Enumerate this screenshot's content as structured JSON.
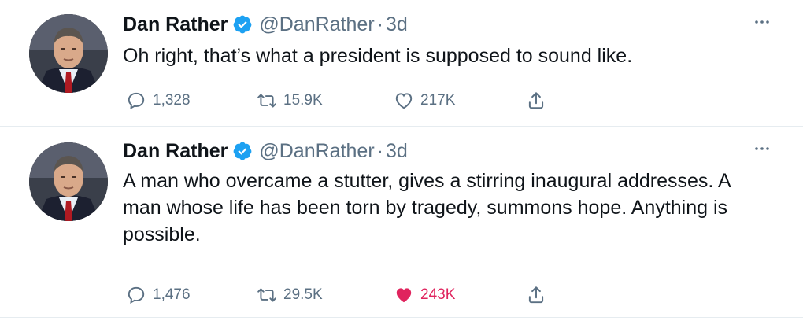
{
  "tweets": [
    {
      "name": "Dan Rather",
      "handle": "@DanRather",
      "separator": "·",
      "time": "3d",
      "text": "Oh right, that’s what a president is supposed to sound like.",
      "reply_count": "1,328",
      "retweet_count": "15.9K",
      "like_count": "217K",
      "liked": false
    },
    {
      "name": "Dan Rather",
      "handle": "@DanRather",
      "separator": "·",
      "time": "3d",
      "text": "A man who overcame a stutter, gives a stirring inaugural addresses. A man whose life has been torn by tragedy, summons hope. Anything is possible.",
      "reply_count": "1,476",
      "retweet_count": "29.5K",
      "like_count": "243K",
      "liked": true
    }
  ],
  "colors": {
    "verified": "#1da1f2",
    "secondary_text": "#5b7083",
    "like_active": "#e0245e",
    "divider": "#e6ecf0"
  }
}
